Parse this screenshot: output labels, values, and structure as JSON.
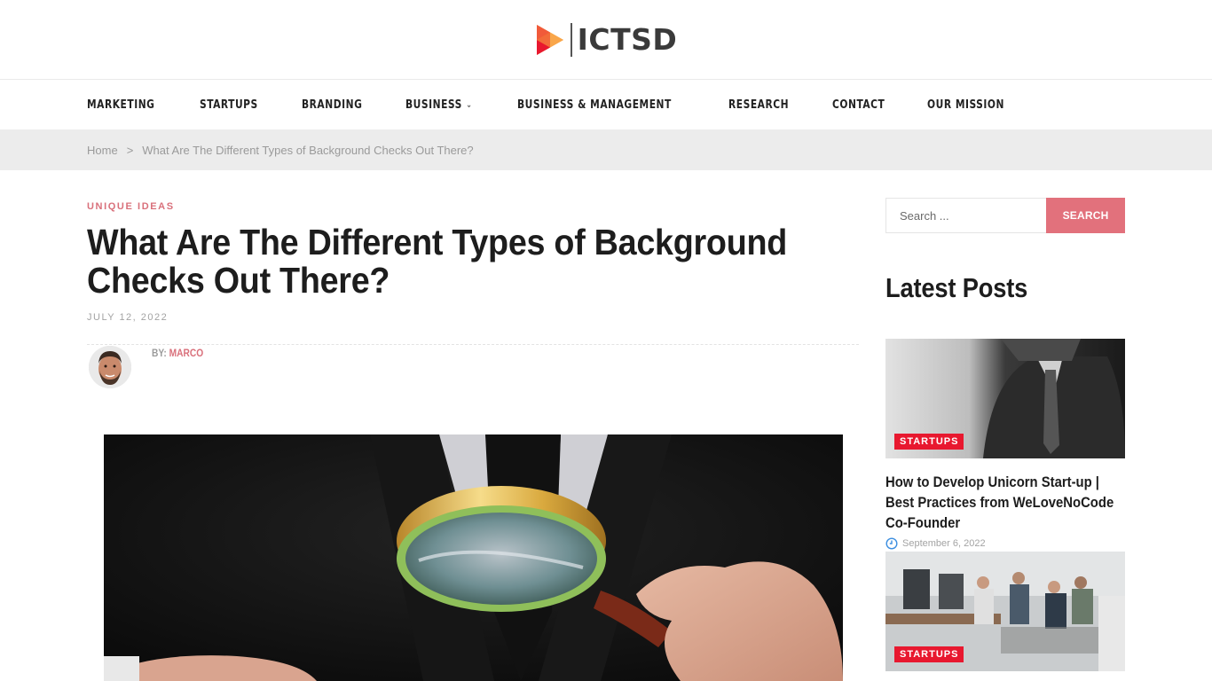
{
  "brand": {
    "name": "ICTSD",
    "logo_colors": [
      "#f15a3a",
      "#f7931e",
      "#e8182f"
    ]
  },
  "nav": {
    "items": [
      {
        "label": "MARKETING",
        "has_dropdown": false
      },
      {
        "label": "STARTUPS",
        "has_dropdown": false
      },
      {
        "label": "BRANDING",
        "has_dropdown": false
      },
      {
        "label": "BUSINESS",
        "has_dropdown": true
      },
      {
        "label": "BUSINESS & MANAGEMENT",
        "has_dropdown": false
      },
      {
        "label": "RESEARCH",
        "has_dropdown": false
      },
      {
        "label": "CONTACT",
        "has_dropdown": false
      },
      {
        "label": "OUR MISSION",
        "has_dropdown": false
      }
    ],
    "dropdown_icon": "chevron-down-icon"
  },
  "breadcrumb": {
    "home": "Home",
    "separator": ">",
    "current": "What Are The Different Types of Background Checks Out There?"
  },
  "article": {
    "category": "UNIQUE IDEAS",
    "title": "What Are The Different Types of Background Checks Out There?",
    "date": "JULY 12, 2022",
    "by_label": "BY:",
    "author": "MARCO",
    "featured_image_alt": "Businessman holding a magnifying glass"
  },
  "sidebar": {
    "search": {
      "placeholder": "Search ...",
      "value": "",
      "button_label": "SEARCH"
    },
    "latest_posts_title": "Latest Posts",
    "posts": [
      {
        "tag": "STARTUPS",
        "title": "How to Develop Unicorn Start-up | Best Practices from WeLoveNoCode Co-Founder",
        "date": "September 6, 2022",
        "thumb_alt": "Man in suit, black and white"
      },
      {
        "tag": "STARTUPS",
        "title": "",
        "date": "",
        "thumb_alt": "Team high-fiving in an office"
      }
    ]
  },
  "colors": {
    "accent": "#e2717c",
    "category_pink": "#d9707b",
    "tag_red": "#e8182f",
    "breadcrumb_bg": "#ececec",
    "clock_blue": "#3b8ee0"
  }
}
